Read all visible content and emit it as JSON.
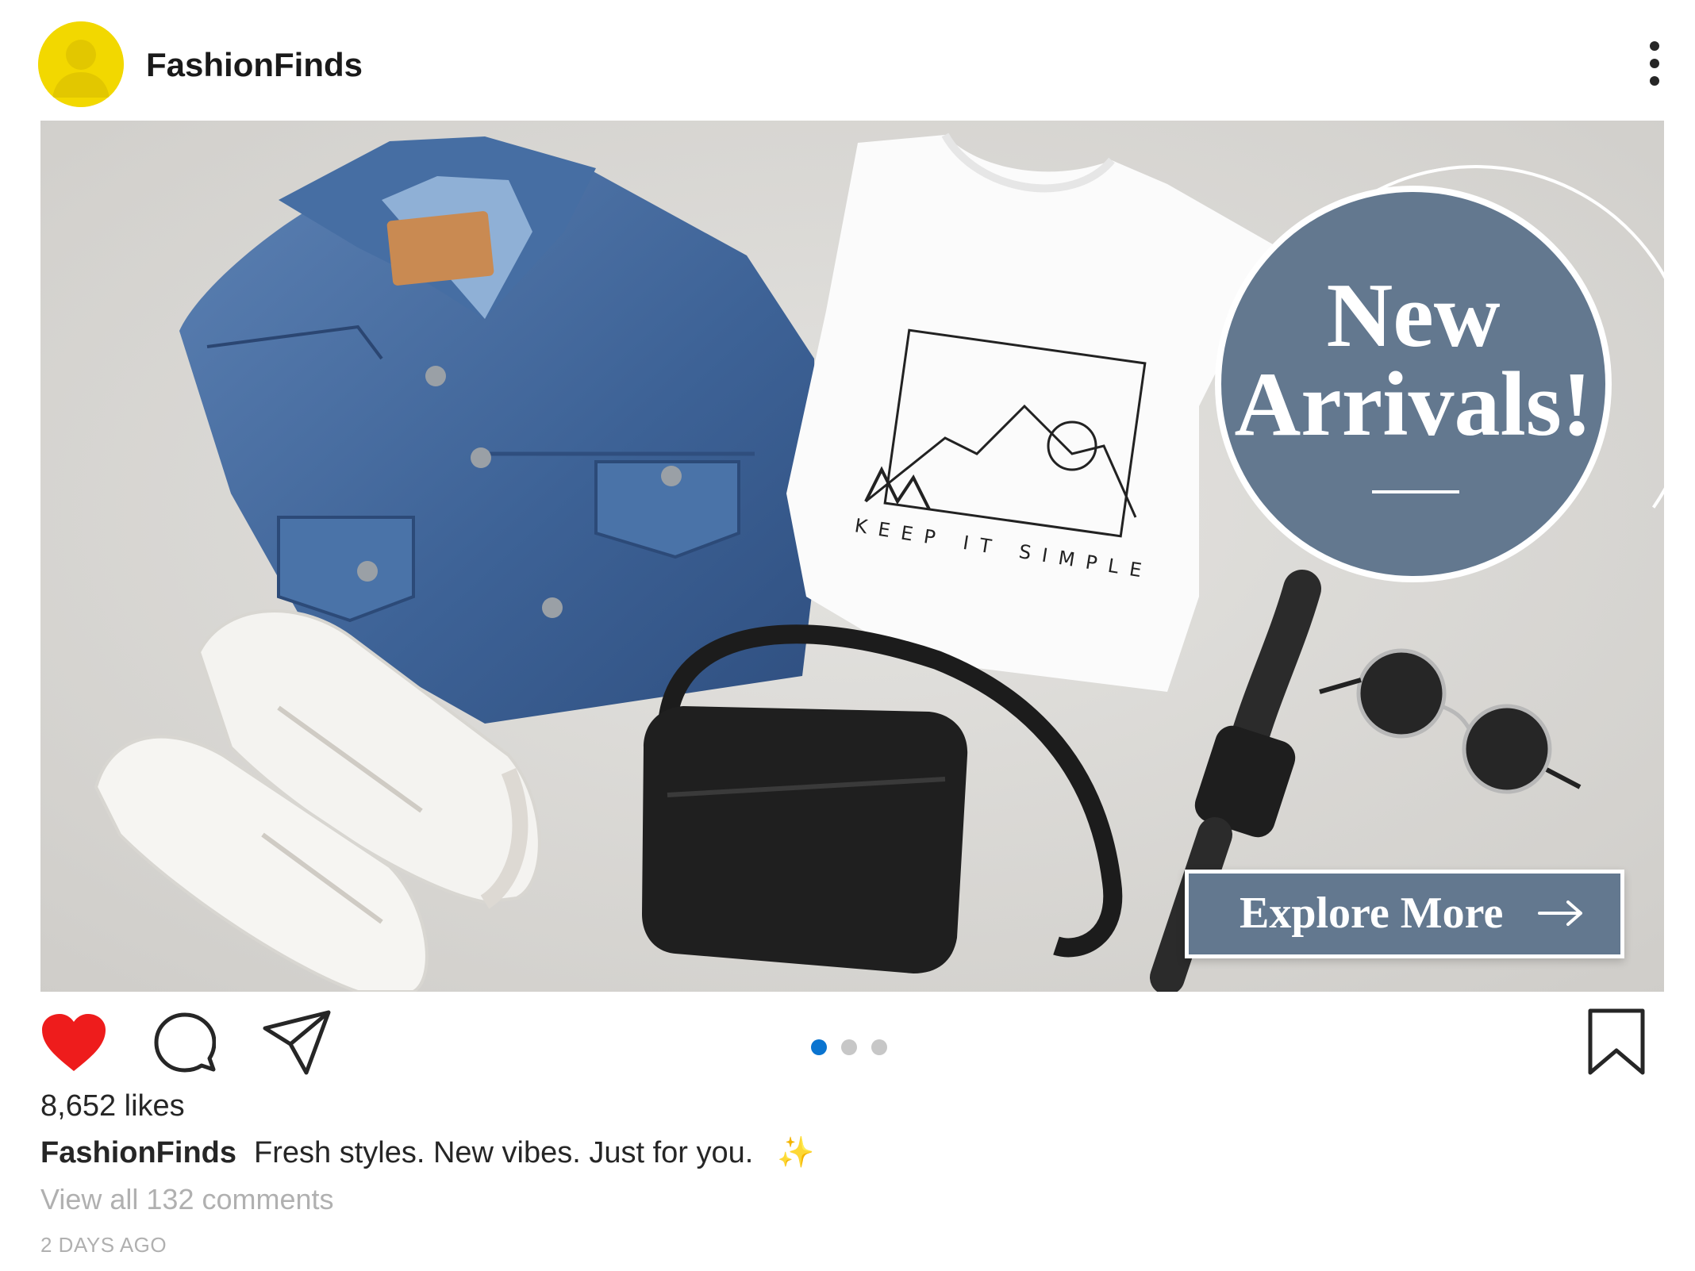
{
  "header": {
    "username": "FashionFinds",
    "avatar_color": "#f2d800",
    "menu_icon": "more-vertical-icon"
  },
  "media": {
    "badge": {
      "line1": "New",
      "line2": "Arrivals!",
      "color": "#63788f"
    },
    "tshirt_print": "KEEP IT SIMPLE",
    "cta": {
      "label": "Explore More",
      "icon": "arrow-right-icon"
    }
  },
  "actions": {
    "like_icon": "heart-icon",
    "like_color": "#ee1c1c",
    "comment_icon": "comment-icon",
    "share_icon": "send-icon",
    "save_icon": "bookmark-icon",
    "carousel": {
      "total": 3,
      "active": 1,
      "active_color": "#0a74d0"
    }
  },
  "post": {
    "likes": "8,652 likes",
    "caption_user": "FashionFinds",
    "caption_text": "Fresh styles. New vibes. Just for you.",
    "caption_emoji": "✨",
    "comments_link": "View all 132 comments",
    "timestamp": "2 DAYS AGO"
  }
}
